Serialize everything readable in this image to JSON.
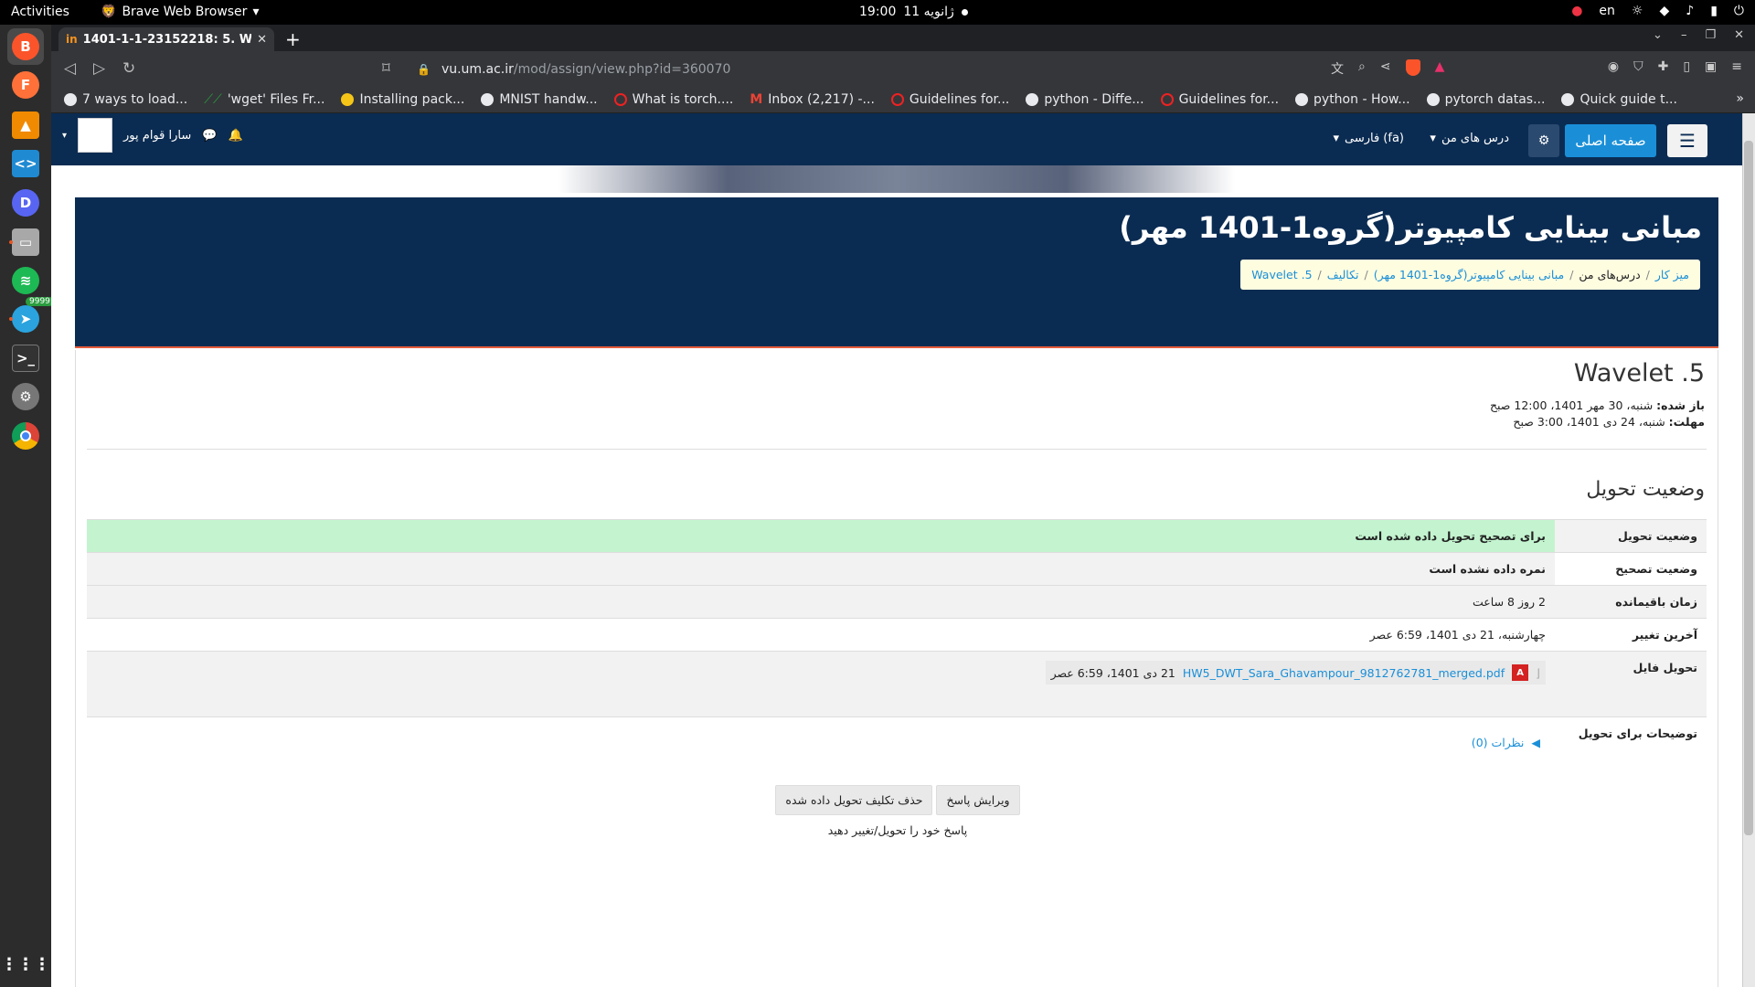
{
  "system": {
    "activities": "Activities",
    "app_name": "Brave Web Browser",
    "clock_time": "19:00",
    "clock_date": "11 ژانویه",
    "lang": "en"
  },
  "dock": {
    "telegram_badge": "9999"
  },
  "browser": {
    "tab_favicon": "in",
    "tab_title": "1401-1-1-23152218: 5. W",
    "url_host": "vu.um.ac.ir",
    "url_path": "/mod/assign/view.php?id=360070",
    "bookmarks": [
      "7 ways to load...",
      "'wget' Files Fr...",
      "Installing pack...",
      "MNIST handw...",
      "What is torch....",
      "Inbox (2,217) -...",
      "Guidelines for...",
      "python - Diffe...",
      "Guidelines for...",
      "python - How...",
      "pytorch datas...",
      "Quick guide t..."
    ]
  },
  "moodle_nav": {
    "home": "صفحه اصلی",
    "my_courses": "درس های من",
    "language": "فارسی (fa)",
    "username": "سارا قوام پور"
  },
  "header": {
    "course_title": "مبانی بینایی کامپیوتر(گروه1-1401 مهر)",
    "breadcrumb": [
      "میز کار",
      "درس‌های من",
      "مبانی بینایی کامپیوتر(گروه1-1401 مهر)",
      "تکالیف",
      "Wavelet .5"
    ]
  },
  "assignment": {
    "title": "Wavelet .5",
    "opened_label": "باز شده:",
    "opened_value": "شنبه، 30 مهر 1401، 12:00 صبح",
    "due_label": "مهلت:",
    "due_value": "شنبه، 24 دی 1401، 3:00 صبح",
    "section_title": "وضعیت تحویل"
  },
  "status_table": {
    "submission_status_label": "وضعیت تحویل",
    "submission_status_value": "برای تصحیح تحویل داده شده است",
    "grading_status_label": "وضعیت تصحیح",
    "grading_status_value": "نمره داده نشده است",
    "time_remaining_label": "زمان باقیمانده",
    "time_remaining_value": "2 روز 8 ساعت",
    "last_modified_label": "آخرین تغییر",
    "last_modified_value": "چهارشنبه، 21 دی 1401، 6:59 عصر",
    "file_submission_label": "تحویل فایل",
    "file_name": "HW5_DWT_Sara_Ghavampour_9812762781_merged.pdf",
    "file_date": "21 دی 1401، 6:59 عصر",
    "comments_label": "توضیحات برای تحویل",
    "comments_link": "نظرات (0)"
  },
  "actions": {
    "edit": "ویرایش پاسخ",
    "remove": "حذف تکلیف تحویل داده شده",
    "note": "پاسخ خود را تحویل/تغییر دهید"
  }
}
